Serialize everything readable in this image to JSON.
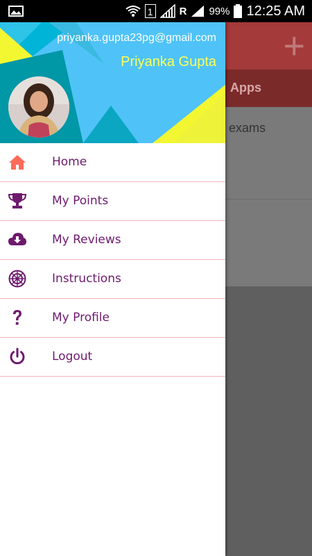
{
  "status_bar": {
    "sim_slot": "1",
    "roaming": "R",
    "battery": "99%",
    "time": "12:25 AM"
  },
  "background_app": {
    "tab_label": "Apps",
    "card_text": "exams"
  },
  "drawer": {
    "email": "priyanka.gupta23pg@gmail.com",
    "name": "Priyanka Gupta",
    "items": [
      {
        "label": "Home",
        "icon": "home-icon"
      },
      {
        "label": "My Points",
        "icon": "trophy-icon"
      },
      {
        "label": "My Reviews",
        "icon": "cloud-download-icon"
      },
      {
        "label": "Instructions",
        "icon": "empire-icon"
      },
      {
        "label": "My Profile",
        "icon": "question-icon"
      },
      {
        "label": "Logout",
        "icon": "power-icon"
      }
    ]
  },
  "colors": {
    "accent_purple": "#6e1a6e",
    "home_icon": "#ff6b5a",
    "divider": "#f2b6b6",
    "name_yellow": "#ffff55"
  }
}
